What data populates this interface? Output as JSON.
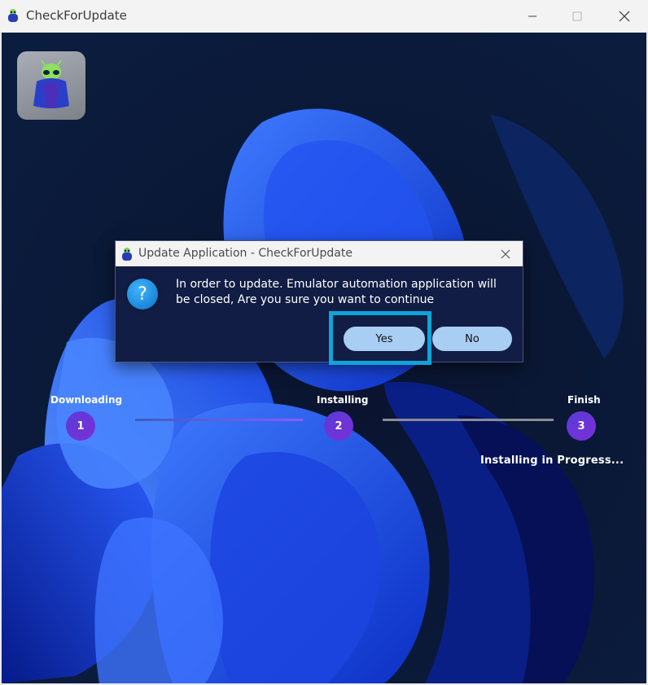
{
  "window": {
    "title": "CheckForUpdate",
    "controls": {
      "minimize": "minimize",
      "maximize": "maximize",
      "close": "close"
    }
  },
  "dialog": {
    "title": "Update Application - CheckForUpdate",
    "message": "In order to update. Emulator automation application will be closed, Are you sure you want to continue",
    "yes_label": "Yes",
    "no_label": "No"
  },
  "steps": [
    {
      "label": "Downloading",
      "number": "1"
    },
    {
      "label": "Installing",
      "number": "2"
    },
    {
      "label": "Finish",
      "number": "3"
    }
  ],
  "status_text": "Installing in Progress...",
  "colors": {
    "accent": "#0ea5d8",
    "button": "#a9cef3",
    "step": "#6a35d8"
  }
}
